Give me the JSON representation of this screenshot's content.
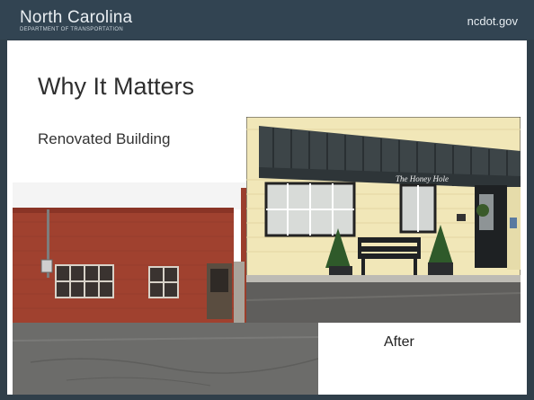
{
  "header": {
    "org_name": "North Carolina",
    "org_subtitle": "DEPARTMENT OF TRANSPORTATION",
    "site": "ncdot.gov"
  },
  "slide": {
    "title": "Why It Matters",
    "subtitle": "Renovated Building",
    "after_label": "After"
  },
  "photo_after": {
    "sign_text": "The Honey Hole"
  },
  "colors": {
    "header_bg": "#324452",
    "frame_bg": "#303f4a",
    "slide_bg": "#ffffff"
  }
}
